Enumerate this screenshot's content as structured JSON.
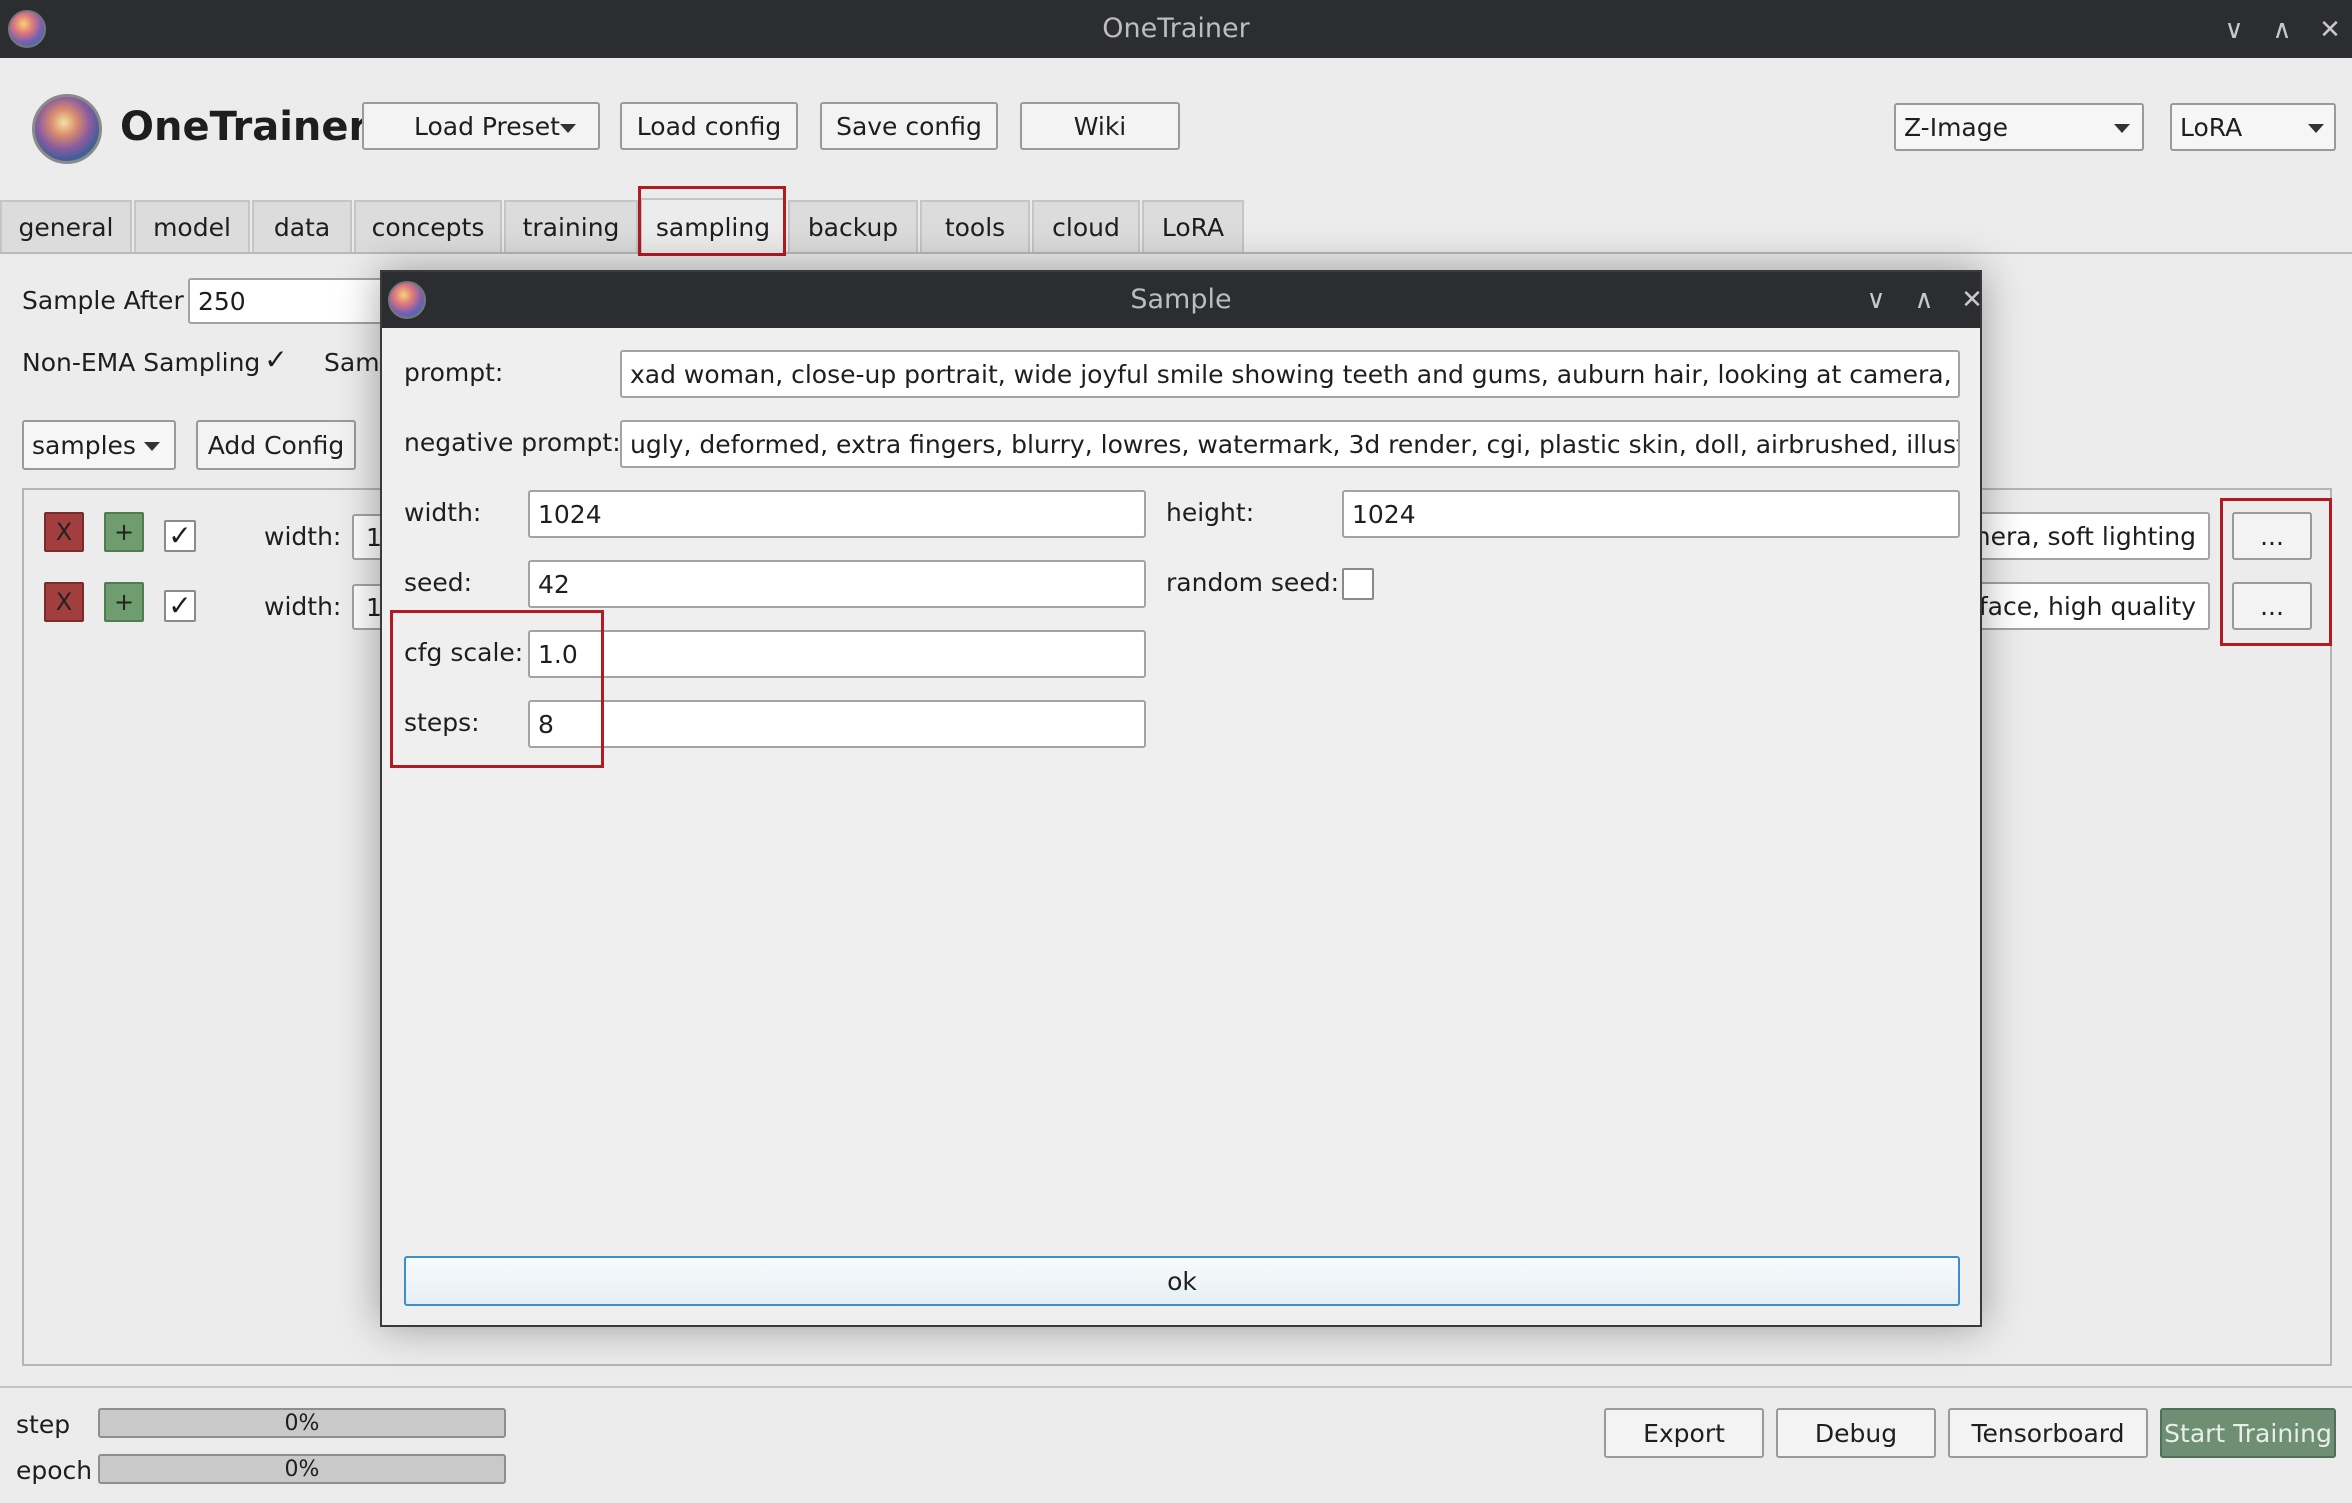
{
  "window": {
    "title": "OneTrainer",
    "controls": {
      "minimize": "∨",
      "maximize": "∧",
      "close": "✕"
    }
  },
  "header": {
    "app_name": "OneTrainer",
    "load_preset": "Load Preset",
    "load_config": "Load config",
    "save_config": "Save config",
    "wiki": "Wiki",
    "model_type": "Z-Image",
    "training_method": "LoRA"
  },
  "tabs": [
    {
      "label": "general"
    },
    {
      "label": "model"
    },
    {
      "label": "data"
    },
    {
      "label": "concepts"
    },
    {
      "label": "training"
    },
    {
      "label": "sampling"
    },
    {
      "label": "backup"
    },
    {
      "label": "tools"
    },
    {
      "label": "cloud"
    },
    {
      "label": "LoRA"
    }
  ],
  "active_tab": "sampling",
  "sampling": {
    "sample_after_label": "Sample After",
    "sample_after_value": "250",
    "non_ema_label": "Non-EMA Sampling",
    "non_ema_checked": "✓",
    "samp_label_partial": "Samp",
    "samples_dropdown": "samples",
    "add_config": "Add Config",
    "rows": [
      {
        "remove": "X",
        "add": "+",
        "enabled": "✓",
        "width_label": "width:",
        "width_value": "1",
        "prompt_tail": "amera, soft lighting",
        "more": "..."
      },
      {
        "remove": "X",
        "add": "+",
        "enabled": "✓",
        "width_label": "width:",
        "width_value": "1",
        "prompt_tail": "d face, high quality",
        "more": "..."
      }
    ]
  },
  "dialog": {
    "title": "Sample",
    "prompt_label": "prompt:",
    "prompt_value": "xad woman, close-up portrait, wide joyful smile showing teeth and gums, auburn hair, looking at camera, soft lighting",
    "negative_label": "negative prompt:",
    "negative_value": "ugly, deformed, extra fingers, blurry, lowres, watermark, 3d render, cgi, plastic skin, doll, airbrushed, illustration",
    "width_label": "width:",
    "width_value": "1024",
    "height_label": "height:",
    "height_value": "1024",
    "seed_label": "seed:",
    "seed_value": "42",
    "random_seed_label": "random seed:",
    "cfg_label": "cfg scale:",
    "cfg_value": "1.0",
    "steps_label": "steps:",
    "steps_value": "8",
    "ok": "ok"
  },
  "footer": {
    "step_label": "step",
    "step_progress": "0%",
    "epoch_label": "epoch",
    "epoch_progress": "0%",
    "export": "Export",
    "debug": "Debug",
    "tensorboard": "Tensorboard",
    "start_training": "Start Training"
  }
}
